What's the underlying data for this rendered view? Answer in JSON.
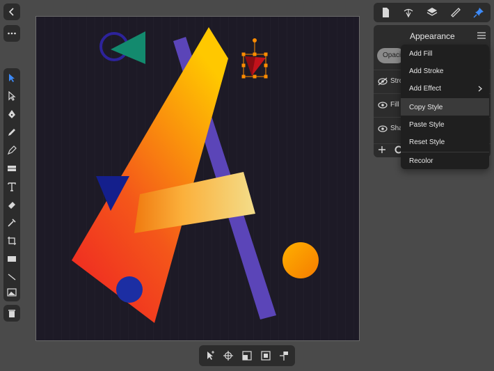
{
  "top_left": {
    "back_icon": "chevron-left-icon",
    "more_icon": "ellipsis-icon"
  },
  "tools": [
    {
      "name": "move-tool",
      "icon": "arrow-pointer-icon",
      "active": true
    },
    {
      "name": "node-tool",
      "icon": "node-arrow-icon"
    },
    {
      "name": "pen-tool",
      "icon": "pen-nib-icon"
    },
    {
      "name": "pencil-tool",
      "icon": "pencil-icon"
    },
    {
      "name": "vector-brush-tool",
      "icon": "brush-icon"
    },
    {
      "name": "fill-tool",
      "icon": "fill-icon"
    },
    {
      "name": "text-tool",
      "icon": "text-icon"
    },
    {
      "name": "eraser-tool",
      "icon": "eraser-icon"
    },
    {
      "name": "color-picker-tool",
      "icon": "eyedropper-icon"
    },
    {
      "name": "crop-tool",
      "icon": "crop-icon"
    },
    {
      "name": "rectangle-tool",
      "icon": "rectangle-icon"
    },
    {
      "name": "line-tool",
      "icon": "line-icon"
    },
    {
      "name": "place-image-tool",
      "icon": "image-icon"
    }
  ],
  "delete_icon": "trash-icon",
  "panel_tabs": [
    "document-icon",
    "pen-node-icon",
    "layers-icon",
    "ruler-icon",
    "pin-icon"
  ],
  "appearance": {
    "title": "Appearance",
    "opacity_label": "Opaci",
    "rows": [
      {
        "label": "Stro"
      },
      {
        "label": "Fill"
      },
      {
        "label": "Sha"
      }
    ]
  },
  "menu": {
    "items": [
      {
        "label": "Add Fill"
      },
      {
        "label": "Add Stroke"
      },
      {
        "label": "Add Effect",
        "submenu": true
      },
      {
        "label": "Copy Style",
        "selected": true
      },
      {
        "label": "Paste Style"
      },
      {
        "label": "Reset Style"
      },
      {
        "label": "Recolor"
      }
    ]
  },
  "bottom_toolbar": [
    "select-icon",
    "crosshair-icon",
    "align-icon",
    "square-icon",
    "flag-icon"
  ],
  "colors": {
    "accent": "#3d8af7",
    "selection": "#ff8c00"
  }
}
